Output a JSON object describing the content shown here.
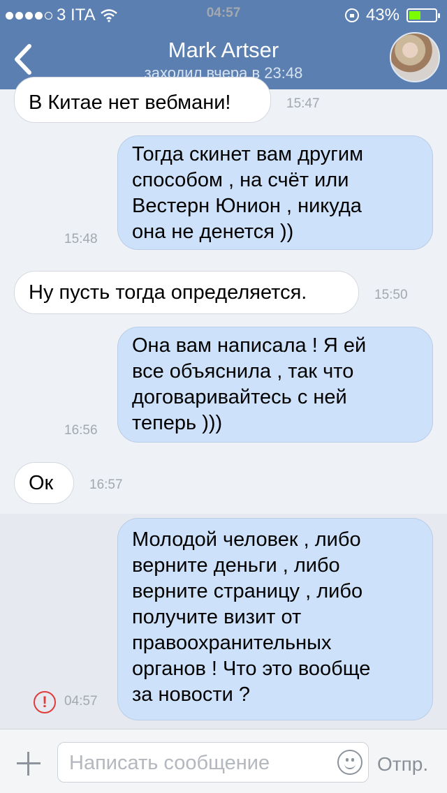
{
  "status_bar": {
    "carrier": "3 ITA",
    "time": "04:57",
    "battery": "43%"
  },
  "nav": {
    "title": "Mark Artser",
    "subtitle": "заходил вчера в 23:48"
  },
  "messages": [
    {
      "direction": "in",
      "text": "В Китае нет вебмани!",
      "time": "15:47"
    },
    {
      "direction": "out",
      "lines": [
        "Тогда скинет вам другим",
        "способом , на счёт или",
        "Вестерн Юнион , никуда",
        "она не денется ))"
      ],
      "time": "15:48"
    },
    {
      "direction": "in",
      "text": "Ну пусть тогда определяется.",
      "time": "15:50"
    },
    {
      "direction": "out",
      "lines": [
        "Она вам написала ! Я ей",
        "все объяснила , так что",
        "договаривайтесь с ней",
        "теперь )))"
      ],
      "time": "16:56"
    },
    {
      "direction": "in",
      "text": "Ок",
      "time": "16:57"
    },
    {
      "direction": "out",
      "lines": [
        "Молодой человек , либо",
        "верните деньги , либо",
        "верните страницу , либо",
        "получите визит от",
        "правоохранительных",
        "органов ! Что это вообще",
        "за новости ?"
      ],
      "time": "04:57",
      "status": "failed",
      "status_glyph": "!"
    }
  ],
  "composer": {
    "placeholder": "Написать сообщение",
    "send_label": "Отпр."
  },
  "colors": {
    "header": "#5a7fb0",
    "incoming_bubble": "#ffffff",
    "outgoing_bubble": "#cde2fa",
    "error": "#e03a3a"
  },
  "icons": [
    "signal-dots-icon",
    "wifi-icon",
    "rotation-lock-icon",
    "battery-icon",
    "back-chevron-icon",
    "error-icon",
    "plus-icon",
    "smiley-icon"
  ]
}
